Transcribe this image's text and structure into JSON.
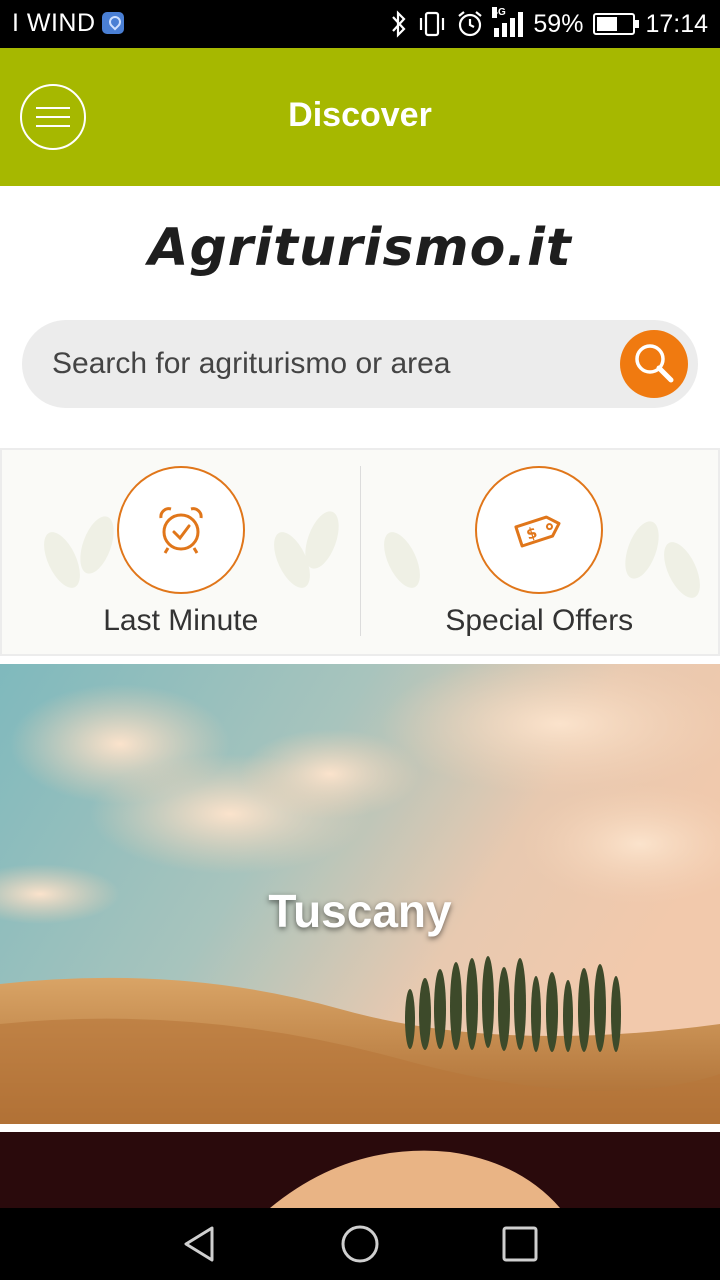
{
  "status_bar": {
    "carrier": "I WIND",
    "battery_text": "59%",
    "battery_level": 0.59,
    "time": "17:14",
    "network_tag": "4G",
    "icons": [
      "location-icon",
      "bluetooth-icon",
      "vibrate-icon",
      "alarm-icon",
      "signal-icon",
      "battery-icon"
    ]
  },
  "header": {
    "title": "Discover",
    "menu_icon": "hamburger-menu-icon",
    "background": "#a6b800"
  },
  "logo": {
    "text": "Agriturismo.it"
  },
  "search": {
    "placeholder": "Search for agriturismo or area",
    "button_icon": "search-icon",
    "button_color": "#f07a10"
  },
  "quick_actions": [
    {
      "label": "Last Minute",
      "icon": "alarm-clock-icon"
    },
    {
      "label": "Special Offers",
      "icon": "price-tag-icon"
    }
  ],
  "regions": [
    {
      "name": "Tuscany"
    }
  ],
  "accent_color": "#e0761a",
  "nav_bar": {
    "icons": [
      "back-icon",
      "home-icon",
      "recents-icon"
    ]
  }
}
